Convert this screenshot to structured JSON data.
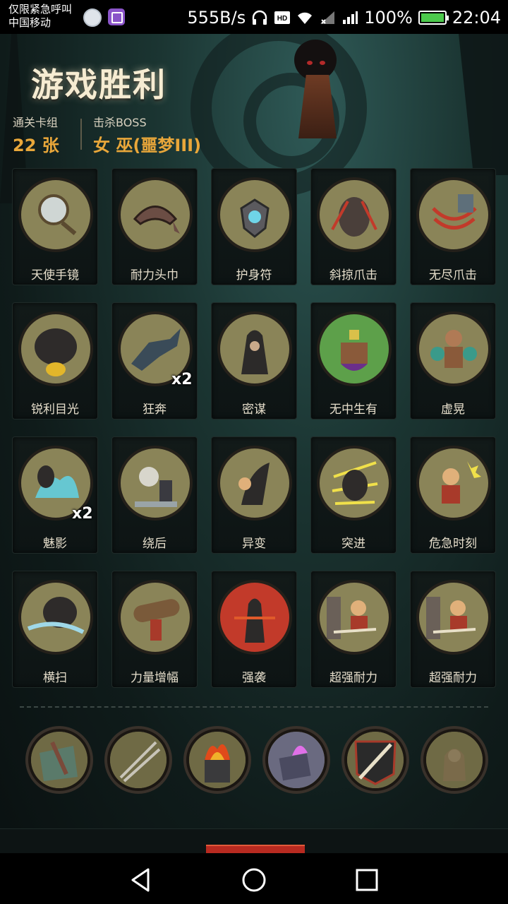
{
  "status_bar": {
    "carrier_line1": "仅限紧急呼叫",
    "carrier_line2": "中国移动",
    "net_speed": "555B/s",
    "battery": "100%",
    "time": "22:04",
    "icons": [
      "avatar-icon",
      "gallery-app-icon",
      "headphones-icon",
      "hd-icon",
      "wifi-icon",
      "signal-icon",
      "signal-4g-icon",
      "battery-icon"
    ]
  },
  "header": {
    "title": "游戏胜利",
    "deck_label": "通关卡组",
    "deck_count": "22",
    "deck_unit": "张",
    "boss_label": "击杀BOSS",
    "boss_name": "女 巫(噩梦III)"
  },
  "cards": [
    {
      "name": "天使手镜",
      "count": "",
      "icon": "hand-mirror-icon"
    },
    {
      "name": "耐力头巾",
      "count": "",
      "icon": "bandana-icon"
    },
    {
      "name": "护身符",
      "count": "",
      "icon": "amulet-icon"
    },
    {
      "name": "斜掠爪击",
      "count": "",
      "icon": "werewolf-claw-icon"
    },
    {
      "name": "无尽爪击",
      "count": "",
      "icon": "claw-strike-icon"
    },
    {
      "name": "锐利目光",
      "count": "",
      "icon": "wolf-roar-icon"
    },
    {
      "name": "狂奔",
      "count": "x2",
      "icon": "running-wolf-icon"
    },
    {
      "name": "密谋",
      "count": "",
      "icon": "hooded-figures-icon"
    },
    {
      "name": "无中生有",
      "count": "",
      "icon": "magic-box-icon"
    },
    {
      "name": "虚晃",
      "count": "",
      "icon": "boxer-icon"
    },
    {
      "name": "魅影",
      "count": "x2",
      "icon": "phantom-icon"
    },
    {
      "name": "绕后",
      "count": "",
      "icon": "skull-ghost-icon"
    },
    {
      "name": "异变",
      "count": "",
      "icon": "mutation-icon"
    },
    {
      "name": "突进",
      "count": "",
      "icon": "dash-wolf-icon"
    },
    {
      "name": "危急时刻",
      "count": "",
      "icon": "crisis-icon"
    },
    {
      "name": "横扫",
      "count": "",
      "icon": "sweep-wolf-icon"
    },
    {
      "name": "力量增幅",
      "count": "",
      "icon": "log-lift-icon"
    },
    {
      "name": "强袭",
      "count": "",
      "icon": "assault-icon"
    },
    {
      "name": "超强耐力",
      "count": "",
      "icon": "endurance-icon"
    },
    {
      "name": "超强耐力",
      "count": "",
      "icon": "endurance-icon"
    }
  ],
  "relics": [
    {
      "icon": "dagger-banner-icon"
    },
    {
      "icon": "twin-blades-icon"
    },
    {
      "icon": "flaming-brazier-icon"
    },
    {
      "icon": "purple-flame-box-icon"
    },
    {
      "icon": "sword-shield-icon"
    },
    {
      "icon": "gargoyle-statue-icon"
    }
  ],
  "navigation": {
    "back": "back-icon",
    "home": "home-icon",
    "recent": "recent-apps-icon"
  }
}
